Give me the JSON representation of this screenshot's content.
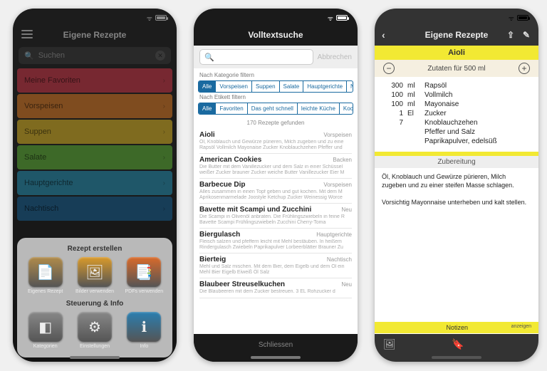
{
  "phone1": {
    "title": "Eigene Rezepte",
    "search_placeholder": "Suchen",
    "categories": [
      {
        "label": "Meine Favoriten",
        "color": "#d94a5a"
      },
      {
        "label": "Vorspeisen",
        "color": "#e88b3a"
      },
      {
        "label": "Suppen",
        "color": "#e8c43a"
      },
      {
        "label": "Salate",
        "color": "#6fbf4a"
      },
      {
        "label": "Hauptgerichte",
        "color": "#3a9fbf"
      },
      {
        "label": "Nachtisch",
        "color": "#2a6f9f"
      }
    ],
    "sheet": {
      "header1": "Rezept erstellen",
      "row1": [
        {
          "label": "Eigenes Rezept",
          "glyph": "📄",
          "bg": "#b08b4a"
        },
        {
          "label": "Bilder verwenden",
          "glyph": "🖼",
          "bg": "#d99a2a"
        },
        {
          "label": "PDFs verwenden",
          "glyph": "📑",
          "bg": "#d96a2a"
        }
      ],
      "header2": "Steuerung & Info",
      "row2": [
        {
          "label": "Kategorien",
          "glyph": "◧",
          "bg": "#888"
        },
        {
          "label": "Einstellungen",
          "glyph": "⚙",
          "bg": "#888"
        },
        {
          "label": "Info",
          "glyph": "ℹ",
          "bg": "#2a7fb0"
        }
      ]
    }
  },
  "phone2": {
    "title": "Volltextsuche",
    "cancel": "Abbrechen",
    "filter1_label": "Nach Kategorie filtern",
    "filter1": [
      "Alle",
      "Vorspeisen",
      "Suppen",
      "Salate",
      "Hauptgerichte",
      "Nachtisch"
    ],
    "filter2_label": "Nach Etikett filtern",
    "filter2": [
      "Alle",
      "Favoriten",
      "Das geht schnell",
      "leichte Küche",
      "Kochen für"
    ],
    "result_count": "170 Rezepte gefunden",
    "results": [
      {
        "title": "Aioli",
        "cat": "Vorspeisen",
        "desc": "Öl, Knoblauch und Gewürze pürieren, Milch zugeben und zu eine Rapsöl Vollmilch Mayonaise Zucker Knoblauchzehen Pfeffer und"
      },
      {
        "title": "American Cookies",
        "cat": "Backen",
        "desc": "Die Butter mit dem Vanillezucker und dem Salz in einer Schüssel weißer Zucker brauner Zucker weiche Butter Vanillezucker Eier M"
      },
      {
        "title": "Barbecue Dip",
        "cat": "Vorspeisen",
        "desc": "Alles zusammen in einen Topf geben und gut kochen. Mit dem M Aprikosenmarmelade Joostyle Ketchup Zucker Weinessig Worce"
      },
      {
        "title": "Bavette mit Scampi und Zucchini",
        "cat": "Neu",
        "desc": "Die Scampi in Olivenöl anbraten. Die Frühlingszwiebeln in feine R Bavette Scampi Frühlingszwiebeln Zucchini Cherry-Toma"
      },
      {
        "title": "Biergulasch",
        "cat": "Hauptgerichte",
        "desc": "Fleisch salzen und pfeffern leicht mit Mehl bestäuben. In heißem Rindergulasch Zwiebeln Paprikapulver Lorbeerblätter Brauner Zu"
      },
      {
        "title": "Bierteig",
        "cat": "Nachtisch",
        "desc": "Mehl und Salz mischen. Mit dem Bier, dem Eigelb und dem Öl ein Mehl Bier Eigelb Eiweiß Öl Salz"
      },
      {
        "title": "Blaubeer Streuselkuchen",
        "cat": "Neu",
        "desc": "Die Blaubeeren mit dem Zucker bestreuen. 3 EL Rohzucker d"
      }
    ],
    "close": "Schliessen"
  },
  "phone3": {
    "title": "Eigene Rezepte",
    "recipe_name": "Aioli",
    "servings": "Zutaten für 500 ml",
    "ingredients": [
      {
        "q": "300",
        "u": "ml",
        "n": "Rapsöl"
      },
      {
        "q": "100",
        "u": "ml",
        "n": "Vollmilch"
      },
      {
        "q": "100",
        "u": "ml",
        "n": "Mayonaise"
      },
      {
        "q": "1",
        "u": "El",
        "n": "Zucker"
      },
      {
        "q": "7",
        "u": "",
        "n": "Knoblauchzehen"
      },
      {
        "q": "",
        "u": "",
        "n": "Pfeffer und Salz"
      },
      {
        "q": "",
        "u": "",
        "n": "Paprikapulver, edelsüß"
      }
    ],
    "prep_label": "Zubereitung",
    "prep_text1": "Öl, Knoblauch und Gewürze pürieren, Milch zugeben und zu einer steifen Masse schlagen.",
    "prep_text2": "Vorsichtig Mayonnaise unterheben und kalt stellen.",
    "notes_label": "Notizen",
    "notes_action": "anzeigen"
  }
}
